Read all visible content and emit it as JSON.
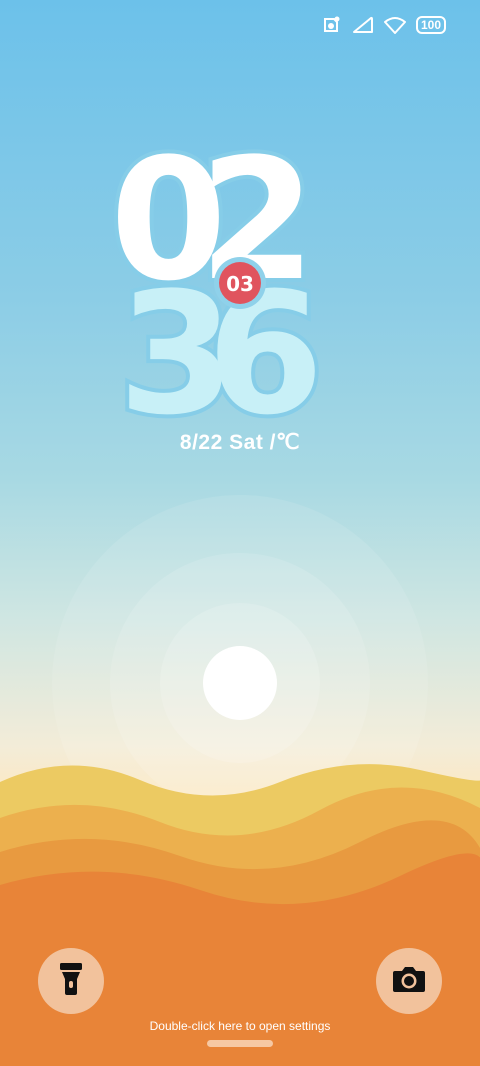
{
  "status_bar": {
    "icons": [
      "notification-icon",
      "signal-icon",
      "wifi-icon"
    ],
    "battery_level": "100"
  },
  "clock": {
    "hour": "02",
    "minute": "36",
    "seconds": "03"
  },
  "date_line": "8/22 Sat /℃",
  "quick_actions": {
    "left_icon": "flashlight-icon",
    "right_icon": "camera-icon"
  },
  "hint_text": "Double-click here to open settings",
  "colors": {
    "sky_top": "#6cc1ea",
    "digit_fill": "#c8f0f7",
    "digit_outline": "#86cde8",
    "seconds_badge": "#e0545e",
    "sand_light": "#ecca62",
    "sand_mid": "#ecb04e",
    "sand_dark": "#e89240",
    "ground": "#e88438",
    "button_bg": "#f2c29c"
  }
}
